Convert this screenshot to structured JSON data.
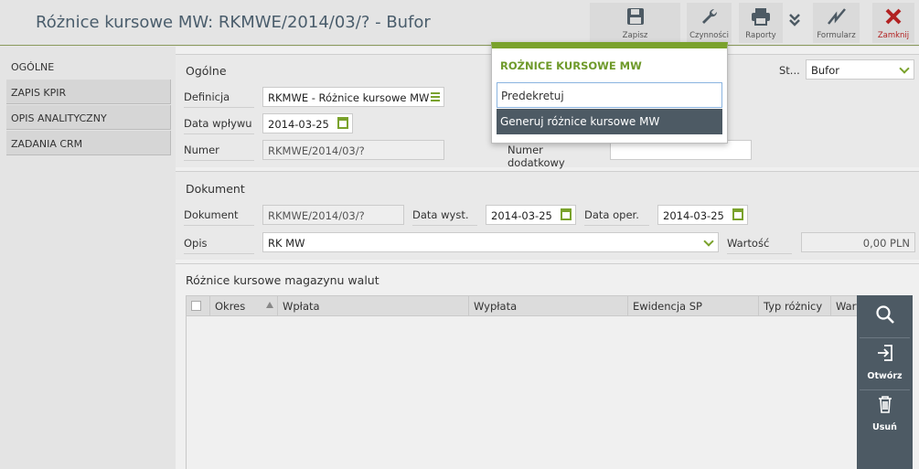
{
  "header": {
    "title": "Różnice kursowe MW: RKMWE/2014/03/? - Bufor",
    "toolbar": {
      "save_label": "Zapisz",
      "actions_label": "Czynności",
      "reports_label": "Raporty",
      "form_label": "Formularz",
      "close_label": "Zamknij"
    }
  },
  "sidebar": {
    "items": [
      {
        "label": "OGÓLNE"
      },
      {
        "label": "ZAPIS KPIR"
      },
      {
        "label": "OPIS ANALITYCZNY"
      },
      {
        "label": "ZADANIA CRM"
      }
    ]
  },
  "general": {
    "title": "Ogólne",
    "definition_label": "Definicja",
    "definition_value": "RKMWE - Różnice kursowe MW",
    "date_in_label": "Data wpływu",
    "date_in_value": "2014-03-25",
    "number_label": "Numer",
    "number_value": "RKMWE/2014/03/?",
    "status_label": "St...",
    "status_value": "Bufor",
    "extra_number_label": "Numer dodatkowy",
    "extra_number_value": ""
  },
  "document": {
    "title": "Dokument",
    "doc_label": "Dokument",
    "doc_value": "RKMWE/2014/03/?",
    "issue_date_label": "Data wyst.",
    "issue_date_value": "2014-03-25",
    "oper_date_label": "Data oper.",
    "oper_date_value": "2014-03-25",
    "desc_label": "Opis",
    "desc_value": "RK MW",
    "value_label": "Wartość",
    "value_value": "0,00 PLN"
  },
  "grid": {
    "title": "Różnice kursowe magazynu walut",
    "columns": [
      "Okres",
      "Wpłata",
      "Wypłata",
      "Ewidencja SP",
      "Typ różnicy",
      "Wart"
    ]
  },
  "side_actions": {
    "open_label": "Otwórz",
    "delete_label": "Usuń"
  },
  "popup": {
    "title": "ROŻNICE KURSOWE MW",
    "items": [
      {
        "label": "Predekretuj"
      },
      {
        "label": "Generuj różnice kursowe MW"
      }
    ]
  },
  "colors": {
    "accent": "#7aa22c",
    "dark": "#4d5a64",
    "close": "#b22222"
  }
}
